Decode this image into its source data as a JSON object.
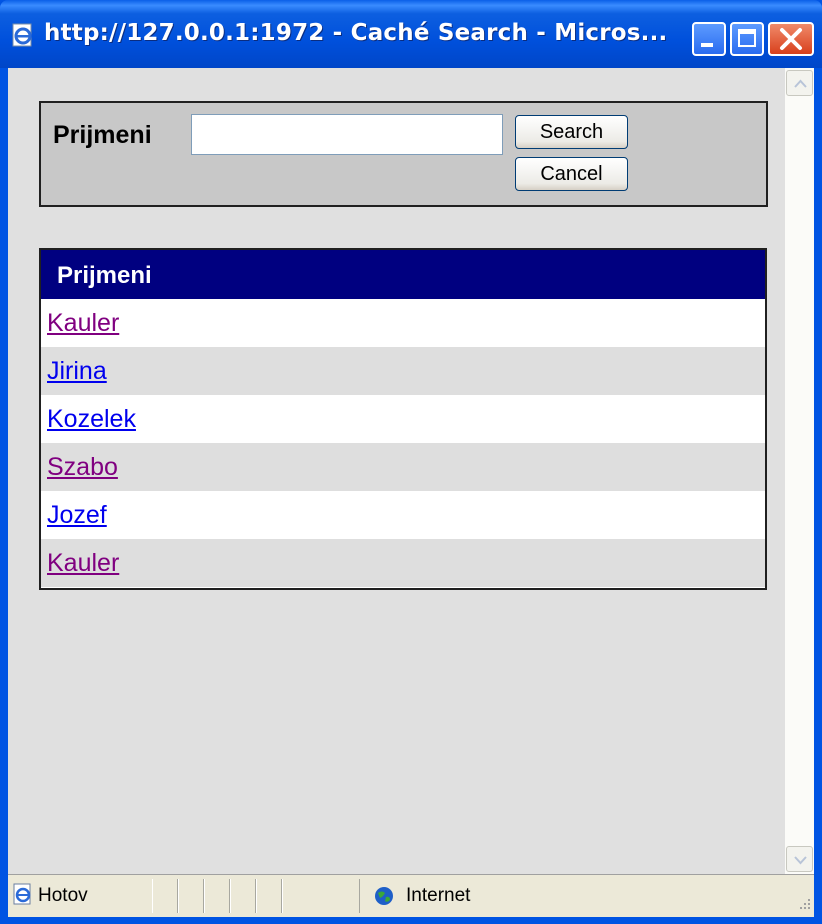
{
  "window": {
    "title": "http://127.0.0.1:1972 - Caché Search - Micros...",
    "buttons": [
      "minimize",
      "maximize",
      "close"
    ]
  },
  "search": {
    "label": "Prijmeni",
    "value": "",
    "search_label": "Search",
    "cancel_label": "Cancel"
  },
  "results": {
    "header": "Prijmeni",
    "rows": [
      {
        "name": "Kauler",
        "visited": true
      },
      {
        "name": "Jirina",
        "visited": false
      },
      {
        "name": "Kozelek",
        "visited": false
      },
      {
        "name": "Szabo",
        "visited": true
      },
      {
        "name": "Jozef",
        "visited": false
      },
      {
        "name": "Kauler",
        "visited": true
      }
    ]
  },
  "statusbar": {
    "status": "Hotov",
    "zone": "Internet",
    "status_icon": "ie-page-icon",
    "zone_icon": "globe-icon"
  },
  "colors": {
    "titlebar": "#0054e3",
    "header_bg": "#000080",
    "visited_link": "#800080",
    "link": "#0000ee"
  }
}
